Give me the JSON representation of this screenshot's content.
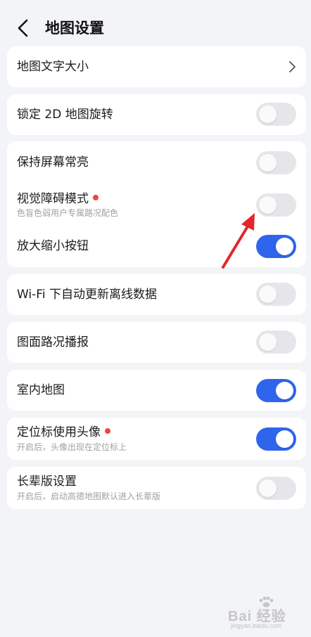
{
  "header": {
    "title": "地图设置"
  },
  "settings": {
    "map_text_size": {
      "label": "地图文字大小"
    },
    "lock_2d_rotation": {
      "label": "锁定 2D 地图旋转",
      "on": false
    },
    "keep_screen_on": {
      "label": "保持屏幕常亮",
      "on": false
    },
    "visual_impairment_mode": {
      "label": "视觉障碍模式",
      "sub": "色盲色弱用户专属路况配色",
      "on": false,
      "new_dot": true
    },
    "zoom_buttons": {
      "label": "放大缩小按钮",
      "on": true
    },
    "wifi_offline_update": {
      "label": "Wi-Fi 下自动更新离线数据",
      "on": false
    },
    "road_condition_broadcast": {
      "label": "图面路况播报",
      "on": false
    },
    "indoor_map": {
      "label": "室内地图",
      "on": true
    },
    "avatar_location_marker": {
      "label": "定位标使用头像",
      "sub": "开启后，头像出现在定位标上",
      "on": true,
      "new_dot": true
    },
    "elder_mode": {
      "label": "长辈版设置",
      "sub": "开启后，启动高德地图默认进入长辈版",
      "on": false
    }
  },
  "colors": {
    "toggle_on": "#2f64ec",
    "toggle_off": "#e6e6ea",
    "badge_dot": "#f04438",
    "annotation_arrow": "#e3262b"
  },
  "icons": {
    "back": "chevron-left-icon",
    "row_arrow": "chevron-right-icon"
  },
  "watermark": {
    "text": "Bai 经验",
    "url": "jingyan.baidu.com"
  }
}
